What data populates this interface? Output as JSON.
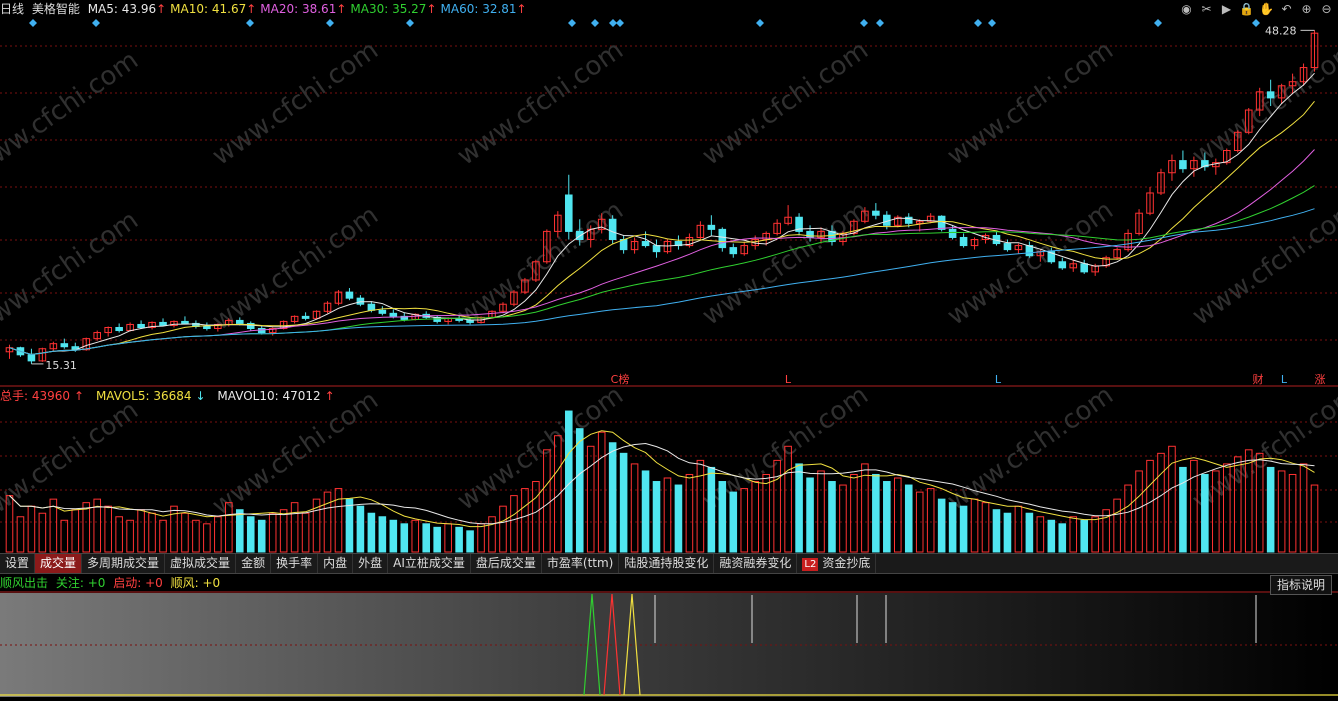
{
  "header": {
    "period": "日线",
    "stock_name": "美格智能",
    "ma": [
      {
        "label": "MA5: 43.96",
        "arrow": "↑",
        "color": "#e8e8e8"
      },
      {
        "label": "MA10: 41.67",
        "arrow": "↑",
        "color": "#f0e040"
      },
      {
        "label": "MA20: 38.61",
        "arrow": "↑",
        "color": "#e060e0"
      },
      {
        "label": "MA30: 35.27",
        "arrow": "↑",
        "color": "#30d030"
      },
      {
        "label": "MA60: 32.81",
        "arrow": "↑",
        "color": "#40b0f0"
      }
    ]
  },
  "toolbar": {
    "icons": [
      "eye-icon",
      "scissors-icon",
      "play-icon",
      "lock-icon",
      "hand-icon",
      "undo-icon",
      "zoom-in-icon",
      "zoom-out-icon"
    ],
    "glyphs": [
      "◉",
      "✂",
      "▶",
      "🔒",
      "✋",
      "↶",
      "⊕",
      "⊖"
    ]
  },
  "price_panel": {
    "high_label": "48.28",
    "low_label": "15.31",
    "markers": [
      "C榜",
      "L",
      "L",
      "财",
      "L",
      "涨"
    ],
    "marker_colors": [
      "#ff4040",
      "#ff4040",
      "#40b0f0",
      "#ff4040",
      "#40b0f0",
      "#ff4040"
    ]
  },
  "volume_panel": {
    "total_label": "总手: 43960",
    "total_arrow": "↑",
    "mavol5_label": "MAVOL5: 36684",
    "mavol5_arrow": "↓",
    "mavol10_label": "MAVOL10: 47012",
    "mavol10_arrow": "↑"
  },
  "tabs": [
    {
      "label": "设置",
      "active": false
    },
    {
      "label": "成交量",
      "active": true
    },
    {
      "label": "多周期成交量",
      "active": false
    },
    {
      "label": "虚拟成交量",
      "active": false
    },
    {
      "label": "金额",
      "active": false
    },
    {
      "label": "换手率",
      "active": false
    },
    {
      "label": "内盘",
      "active": false
    },
    {
      "label": "外盘",
      "active": false
    },
    {
      "label": "AI立桩成交量",
      "active": false
    },
    {
      "label": "盘后成交量",
      "active": false
    },
    {
      "label": "市盈率(ttm)",
      "active": false
    },
    {
      "label": "陆股通持股变化",
      "active": false
    },
    {
      "label": "融资融券变化",
      "active": false
    },
    {
      "label": "资金抄底",
      "active": false,
      "badge": "L2"
    }
  ],
  "indicator_panel": {
    "name": "顺风出击",
    "focus_label": "关注: +0",
    "start_label": "启动: +0",
    "wind_label": "顺风: +0",
    "help_button": "指标说明"
  },
  "watermark": "www.cfchi.com",
  "colors": {
    "up": "#ff3232",
    "down": "#50e6f0",
    "grid": "#7a1010",
    "ma5": "#e8e8e8",
    "ma10": "#f0e040",
    "ma20": "#e060e0",
    "ma30": "#30d030",
    "ma60": "#40b0f0"
  },
  "chart_data": {
    "type": "candlestick",
    "price_range": [
      15.31,
      48.28
    ],
    "candles": [
      [
        16.5,
        17.2,
        15.8,
        16.9
      ],
      [
        16.9,
        17.0,
        16.0,
        16.2
      ],
      [
        16.2,
        16.8,
        15.3,
        15.6
      ],
      [
        15.6,
        16.9,
        15.5,
        16.8
      ],
      [
        16.8,
        17.5,
        16.6,
        17.3
      ],
      [
        17.3,
        17.8,
        16.8,
        17.0
      ],
      [
        17.0,
        17.4,
        16.5,
        16.7
      ],
      [
        16.7,
        17.9,
        16.6,
        17.8
      ],
      [
        17.8,
        18.6,
        17.6,
        18.4
      ],
      [
        18.4,
        19.0,
        18.0,
        18.9
      ],
      [
        18.9,
        19.3,
        18.4,
        18.6
      ],
      [
        18.6,
        19.4,
        18.5,
        19.2
      ],
      [
        19.2,
        19.6,
        18.8,
        18.9
      ],
      [
        18.9,
        19.5,
        18.7,
        19.4
      ],
      [
        19.4,
        19.8,
        19.0,
        19.1
      ],
      [
        19.1,
        19.6,
        18.9,
        19.5
      ],
      [
        19.5,
        20.0,
        19.2,
        19.3
      ],
      [
        19.3,
        19.6,
        18.8,
        19.0
      ],
      [
        19.0,
        19.4,
        18.6,
        18.8
      ],
      [
        18.8,
        19.3,
        18.5,
        19.2
      ],
      [
        19.2,
        19.8,
        19.0,
        19.6
      ],
      [
        19.6,
        19.9,
        19.1,
        19.3
      ],
      [
        19.3,
        19.5,
        18.6,
        18.8
      ],
      [
        18.8,
        19.1,
        18.2,
        18.4
      ],
      [
        18.4,
        18.9,
        18.1,
        18.8
      ],
      [
        18.8,
        19.6,
        18.7,
        19.5
      ],
      [
        19.5,
        20.1,
        19.3,
        20.0
      ],
      [
        20.0,
        20.4,
        19.6,
        19.8
      ],
      [
        19.8,
        20.6,
        19.7,
        20.5
      ],
      [
        20.5,
        21.5,
        20.3,
        21.3
      ],
      [
        21.3,
        22.6,
        21.1,
        22.4
      ],
      [
        22.4,
        22.8,
        21.6,
        21.8
      ],
      [
        21.8,
        22.1,
        21.0,
        21.2
      ],
      [
        21.2,
        21.5,
        20.4,
        20.6
      ],
      [
        20.6,
        21.0,
        20.1,
        20.3
      ],
      [
        20.3,
        20.7,
        19.8,
        20.0
      ],
      [
        20.0,
        20.4,
        19.5,
        19.7
      ],
      [
        19.7,
        20.3,
        19.6,
        20.2
      ],
      [
        20.2,
        20.5,
        19.7,
        19.9
      ],
      [
        19.9,
        20.1,
        19.3,
        19.5
      ],
      [
        19.5,
        19.9,
        19.2,
        19.8
      ],
      [
        19.8,
        20.1,
        19.4,
        19.6
      ],
      [
        19.6,
        19.9,
        19.2,
        19.4
      ],
      [
        19.4,
        20.0,
        19.3,
        19.9
      ],
      [
        19.9,
        20.6,
        19.8,
        20.5
      ],
      [
        20.5,
        21.4,
        20.3,
        21.2
      ],
      [
        21.2,
        22.6,
        21.0,
        22.4
      ],
      [
        22.4,
        23.8,
        22.2,
        23.6
      ],
      [
        23.6,
        25.6,
        23.4,
        25.4
      ],
      [
        25.4,
        28.6,
        25.2,
        28.4
      ],
      [
        28.4,
        30.4,
        27.8,
        30.0
      ],
      [
        32.0,
        34.0,
        27.6,
        28.4
      ],
      [
        28.4,
        29.6,
        27.0,
        27.6
      ],
      [
        27.6,
        29.0,
        26.8,
        28.6
      ],
      [
        28.6,
        30.2,
        28.2,
        29.6
      ],
      [
        29.6,
        30.0,
        27.2,
        27.6
      ],
      [
        27.6,
        28.0,
        26.2,
        26.6
      ],
      [
        26.6,
        27.8,
        26.2,
        27.4
      ],
      [
        27.4,
        28.4,
        26.8,
        27.0
      ],
      [
        27.0,
        27.6,
        25.8,
        26.4
      ],
      [
        26.4,
        27.6,
        26.2,
        27.4
      ],
      [
        27.4,
        28.0,
        26.6,
        27.0
      ],
      [
        27.0,
        28.2,
        26.8,
        27.8
      ],
      [
        27.8,
        29.4,
        27.6,
        29.0
      ],
      [
        29.0,
        30.0,
        28.0,
        28.6
      ],
      [
        28.6,
        28.8,
        26.4,
        26.8
      ],
      [
        26.8,
        27.2,
        25.8,
        26.2
      ],
      [
        26.2,
        27.4,
        26.0,
        27.0
      ],
      [
        27.0,
        28.0,
        26.6,
        27.6
      ],
      [
        27.6,
        28.4,
        27.0,
        28.2
      ],
      [
        28.2,
        29.6,
        28.0,
        29.2
      ],
      [
        29.2,
        31.0,
        29.0,
        29.8
      ],
      [
        29.8,
        30.2,
        28.0,
        28.4
      ],
      [
        28.4,
        29.0,
        27.4,
        27.8
      ],
      [
        27.8,
        28.8,
        27.2,
        28.4
      ],
      [
        28.4,
        29.0,
        27.0,
        27.4
      ],
      [
        27.4,
        28.4,
        27.0,
        28.2
      ],
      [
        28.2,
        29.6,
        28.0,
        29.4
      ],
      [
        29.4,
        30.8,
        29.2,
        30.4
      ],
      [
        30.4,
        31.2,
        29.6,
        30.0
      ],
      [
        30.0,
        30.4,
        28.6,
        29.0
      ],
      [
        29.0,
        30.0,
        28.8,
        29.8
      ],
      [
        29.8,
        30.2,
        28.8,
        29.2
      ],
      [
        29.2,
        29.6,
        28.4,
        29.4
      ],
      [
        29.4,
        30.2,
        29.2,
        29.9
      ],
      [
        29.9,
        30.0,
        28.4,
        28.6
      ],
      [
        28.6,
        29.0,
        27.6,
        27.8
      ],
      [
        27.8,
        28.2,
        26.8,
        27.0
      ],
      [
        27.0,
        27.8,
        26.6,
        27.6
      ],
      [
        27.6,
        28.2,
        27.2,
        28.0
      ],
      [
        28.0,
        28.4,
        27.0,
        27.2
      ],
      [
        27.2,
        27.6,
        26.4,
        26.6
      ],
      [
        26.6,
        27.2,
        26.2,
        27.0
      ],
      [
        27.0,
        27.4,
        25.8,
        26.0
      ],
      [
        26.0,
        26.6,
        25.4,
        26.4
      ],
      [
        26.4,
        26.8,
        25.2,
        25.4
      ],
      [
        25.4,
        25.8,
        24.6,
        24.8
      ],
      [
        24.8,
        25.6,
        24.4,
        25.2
      ],
      [
        25.2,
        25.6,
        24.2,
        24.4
      ],
      [
        24.4,
        25.2,
        24.0,
        25.0
      ],
      [
        25.0,
        26.0,
        24.8,
        25.8
      ],
      [
        25.8,
        26.8,
        25.6,
        26.6
      ],
      [
        26.6,
        28.6,
        26.4,
        28.2
      ],
      [
        28.2,
        30.6,
        28.0,
        30.2
      ],
      [
        30.2,
        32.8,
        30.0,
        32.2
      ],
      [
        32.2,
        34.6,
        32.0,
        34.2
      ],
      [
        34.2,
        36.0,
        33.4,
        35.4
      ],
      [
        35.4,
        36.4,
        34.2,
        34.6
      ],
      [
        34.6,
        35.8,
        33.8,
        35.4
      ],
      [
        35.4,
        36.2,
        34.4,
        34.8
      ],
      [
        34.8,
        35.6,
        34.0,
        35.2
      ],
      [
        35.2,
        36.6,
        35.0,
        36.4
      ],
      [
        36.4,
        38.4,
        36.2,
        38.2
      ],
      [
        38.2,
        40.6,
        38.0,
        40.4
      ],
      [
        40.4,
        42.6,
        39.8,
        42.2
      ],
      [
        42.2,
        43.4,
        40.8,
        41.6
      ],
      [
        41.6,
        43.0,
        41.0,
        42.8
      ],
      [
        42.8,
        44.0,
        42.0,
        43.2
      ],
      [
        43.2,
        45.0,
        42.8,
        44.6
      ],
      [
        44.6,
        48.28,
        44.2,
        48.0
      ]
    ],
    "volume": [
      [
        32,
        "u"
      ],
      [
        20,
        "u"
      ],
      [
        26,
        "u"
      ],
      [
        22,
        "u"
      ],
      [
        30,
        "u"
      ],
      [
        18,
        "u"
      ],
      [
        24,
        "u"
      ],
      [
        28,
        "u"
      ],
      [
        30,
        "u"
      ],
      [
        26,
        "u"
      ],
      [
        20,
        "u"
      ],
      [
        18,
        "u"
      ],
      [
        24,
        "u"
      ],
      [
        22,
        "u"
      ],
      [
        18,
        "u"
      ],
      [
        26,
        "u"
      ],
      [
        22,
        "u"
      ],
      [
        18,
        "u"
      ],
      [
        16,
        "u"
      ],
      [
        20,
        "u"
      ],
      [
        28,
        "u"
      ],
      [
        24,
        "d"
      ],
      [
        20,
        "d"
      ],
      [
        18,
        "d"
      ],
      [
        22,
        "u"
      ],
      [
        24,
        "u"
      ],
      [
        28,
        "u"
      ],
      [
        22,
        "u"
      ],
      [
        30,
        "u"
      ],
      [
        34,
        "u"
      ],
      [
        36,
        "u"
      ],
      [
        30,
        "d"
      ],
      [
        26,
        "d"
      ],
      [
        22,
        "d"
      ],
      [
        20,
        "d"
      ],
      [
        18,
        "d"
      ],
      [
        16,
        "d"
      ],
      [
        18,
        "u"
      ],
      [
        16,
        "d"
      ],
      [
        14,
        "d"
      ],
      [
        16,
        "u"
      ],
      [
        14,
        "d"
      ],
      [
        12,
        "d"
      ],
      [
        16,
        "u"
      ],
      [
        20,
        "u"
      ],
      [
        26,
        "u"
      ],
      [
        32,
        "u"
      ],
      [
        36,
        "u"
      ],
      [
        40,
        "u"
      ],
      [
        58,
        "u"
      ],
      [
        66,
        "u"
      ],
      [
        80,
        "d"
      ],
      [
        70,
        "d"
      ],
      [
        60,
        "u"
      ],
      [
        68,
        "u"
      ],
      [
        62,
        "d"
      ],
      [
        56,
        "d"
      ],
      [
        50,
        "u"
      ],
      [
        46,
        "d"
      ],
      [
        40,
        "d"
      ],
      [
        42,
        "u"
      ],
      [
        38,
        "d"
      ],
      [
        44,
        "u"
      ],
      [
        52,
        "u"
      ],
      [
        48,
        "d"
      ],
      [
        40,
        "d"
      ],
      [
        34,
        "d"
      ],
      [
        36,
        "u"
      ],
      [
        40,
        "u"
      ],
      [
        44,
        "u"
      ],
      [
        52,
        "u"
      ],
      [
        60,
        "u"
      ],
      [
        50,
        "d"
      ],
      [
        42,
        "d"
      ],
      [
        46,
        "u"
      ],
      [
        40,
        "d"
      ],
      [
        38,
        "u"
      ],
      [
        44,
        "u"
      ],
      [
        50,
        "u"
      ],
      [
        44,
        "d"
      ],
      [
        40,
        "d"
      ],
      [
        42,
        "u"
      ],
      [
        38,
        "d"
      ],
      [
        34,
        "u"
      ],
      [
        36,
        "u"
      ],
      [
        30,
        "d"
      ],
      [
        28,
        "d"
      ],
      [
        26,
        "d"
      ],
      [
        30,
        "u"
      ],
      [
        28,
        "u"
      ],
      [
        24,
        "d"
      ],
      [
        22,
        "d"
      ],
      [
        26,
        "u"
      ],
      [
        22,
        "d"
      ],
      [
        20,
        "u"
      ],
      [
        18,
        "d"
      ],
      [
        16,
        "d"
      ],
      [
        20,
        "u"
      ],
      [
        18,
        "d"
      ],
      [
        20,
        "u"
      ],
      [
        24,
        "u"
      ],
      [
        30,
        "u"
      ],
      [
        38,
        "u"
      ],
      [
        46,
        "u"
      ],
      [
        52,
        "u"
      ],
      [
        56,
        "u"
      ],
      [
        60,
        "u"
      ],
      [
        48,
        "d"
      ],
      [
        52,
        "u"
      ],
      [
        44,
        "d"
      ],
      [
        46,
        "u"
      ],
      [
        50,
        "u"
      ],
      [
        54,
        "u"
      ],
      [
        58,
        "u"
      ],
      [
        56,
        "u"
      ],
      [
        48,
        "d"
      ],
      [
        46,
        "u"
      ],
      [
        44,
        "u"
      ],
      [
        50,
        "u"
      ],
      [
        38,
        "u"
      ]
    ],
    "signals": {
      "diamond_count": 14,
      "spike_colors": [
        "#30d030",
        "#ff3232",
        "#f0e040"
      ]
    }
  }
}
